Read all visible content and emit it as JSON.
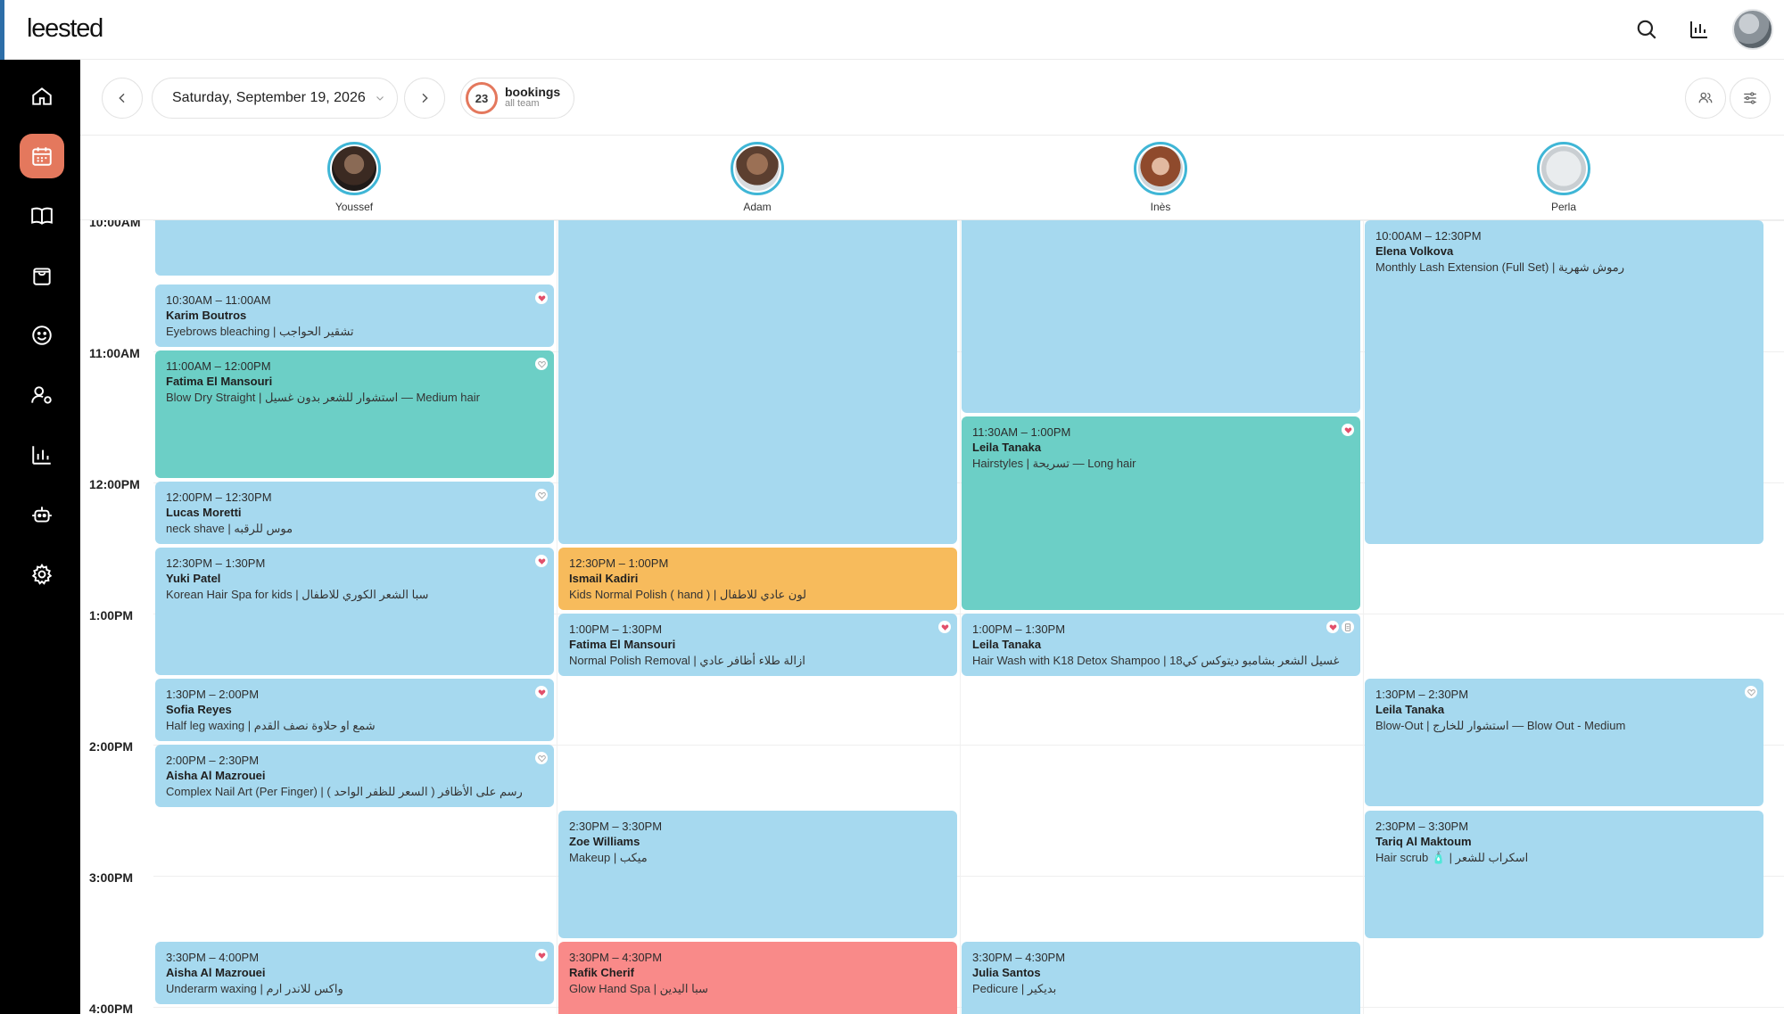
{
  "app": {
    "logo": "leested"
  },
  "toolbar": {
    "date": "Saturday, September 19, 2026",
    "bookings_count": "23",
    "bookings_label": "bookings",
    "bookings_sub": "all team"
  },
  "staff": [
    {
      "name": "Youssef"
    },
    {
      "name": "Adam"
    },
    {
      "name": "Inès"
    },
    {
      "name": "Perla"
    }
  ],
  "times": [
    "10:00AM",
    "11:00AM",
    "12:00PM",
    "1:00PM",
    "2:00PM",
    "3:00PM",
    "4:00PM"
  ],
  "sidebar": {
    "items": [
      "home-icon",
      "calendar-icon",
      "book-icon",
      "shopping-bag-icon",
      "smile-icon",
      "user-settings-icon",
      "bar-chart-icon",
      "robot-icon",
      "gear-icon"
    ]
  },
  "appointments": {
    "youssef": [
      {
        "time": "10:30AM – 11:00AM",
        "name": "Karim Boutros",
        "service": "Eyebrows bleaching | تشقير الحواجب"
      },
      {
        "time": "11:00AM – 12:00PM",
        "name": "Fatima El Mansouri",
        "service": "Blow Dry Straight | استشوار للشعر بدون غسيل — Medium hair"
      },
      {
        "time": "12:00PM – 12:30PM",
        "name": "Lucas Moretti",
        "service": "neck shave | موس للرقبه"
      },
      {
        "time": "12:30PM – 1:30PM",
        "name": "Yuki Patel",
        "service": "Korean Hair Spa for kids | سبا الشعر الكوري للاطفال"
      },
      {
        "time": "1:30PM – 2:00PM",
        "name": "Sofia Reyes",
        "service": "Half leg waxing | شمع او حلاوة نصف القدم"
      },
      {
        "time": "2:00PM – 2:30PM",
        "name": "Aisha Al Mazrouei",
        "service": "Complex Nail Art (Per Finger) | ( رسم على الأظافر ( السعر للظفر الواحد"
      },
      {
        "time": "3:30PM – 4:00PM",
        "name": "Aisha Al Mazrouei",
        "service": "Underarm waxing | واكس للاندر ارم"
      }
    ],
    "adam": [
      {
        "time": "12:30PM – 1:00PM",
        "name": "Ismail Kadiri",
        "service": "Kids Normal Polish ( hand ) | لون عادي للاطفال"
      },
      {
        "time": "1:00PM – 1:30PM",
        "name": "Fatima El Mansouri",
        "service": "Normal Polish Removal | ازالة طلاء أظافر عادي"
      },
      {
        "time": "2:30PM – 3:30PM",
        "name": "Zoe Williams",
        "service": "Makeup | ميكب"
      },
      {
        "time": "3:30PM – 4:30PM",
        "name": "Rafik Cherif",
        "service": "Glow Hand Spa | سبا اليدين"
      }
    ],
    "ines": [
      {
        "time": "11:30AM – 1:00PM",
        "name": "Leila Tanaka",
        "service": "Hairstyles | تسريحة — Long hair"
      },
      {
        "time": "1:00PM – 1:30PM",
        "name": "Leila Tanaka",
        "service": "Hair Wash with K18 Detox Shampoo | غسيل الشعر بشامبو ديتوكس كي18"
      },
      {
        "time": "3:30PM – 4:30PM",
        "name": "Julia Santos",
        "service": "Pedicure | بديكير"
      }
    ],
    "perla": [
      {
        "time": "10:00AM – 12:30PM",
        "name": "Elena Volkova",
        "service": "Monthly Lash Extension (Full Set) | رموش شهرية"
      },
      {
        "time": "1:30PM – 2:30PM",
        "name": "Leila Tanaka",
        "service": "Blow-Out | استشوار للخارج — Blow Out - Medium"
      },
      {
        "time": "2:30PM – 3:30PM",
        "name": "Tariq Al Maktoum",
        "service": "Hair scrub 🧴 | اسكراب للشعر"
      }
    ]
  },
  "colors": {
    "accent": "#e4785d",
    "booking_blue": "#a6d9ef",
    "booking_teal": "#6ccfc6",
    "booking_orange": "#f7bb5c",
    "booking_red": "#f98a89",
    "staff_ring": "#3fb6d6"
  }
}
